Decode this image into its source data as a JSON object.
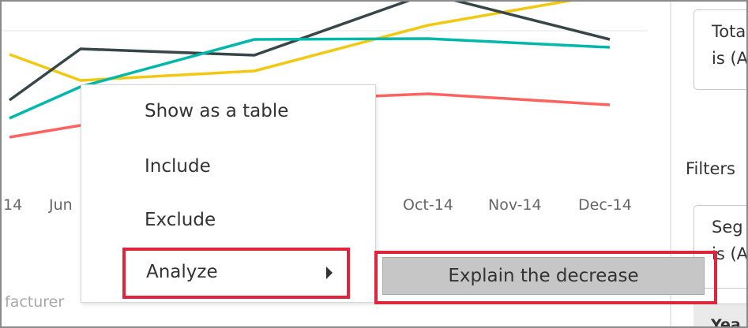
{
  "chart_data": {
    "type": "line",
    "x_tick_labels": [
      "14",
      "Jun",
      "Oct-14",
      "Nov-14",
      "Dec-14"
    ],
    "series": [
      {
        "color": "#f2c811",
        "values": [
          67,
          100,
          88,
          30,
          -10
        ]
      },
      {
        "color": "#374649",
        "values": [
          125,
          60,
          68,
          -10,
          48
        ]
      },
      {
        "color": "#01b8aa",
        "values": [
          148,
          108,
          48,
          47,
          58
        ]
      },
      {
        "color": "#fd625e",
        "values": [
          172,
          157,
          126,
          117,
          131
        ]
      }
    ],
    "legend_fragment": "facturer"
  },
  "context_menu": {
    "items": [
      "Show as a table",
      "Include",
      "Exclude"
    ],
    "analyze_label": "Analyze"
  },
  "submenu": {
    "item_label": "Explain the decrease"
  },
  "right_panel": {
    "card1_line1": "Tota",
    "card1_line2": "is (A",
    "filters_heading": "Filters",
    "card2_line1": "Seg",
    "card2_line2": "is (A",
    "year_label": "Yea"
  },
  "colors": {
    "highlight_red": "#e0243c",
    "submenu_bg": "#c6c6c6"
  }
}
